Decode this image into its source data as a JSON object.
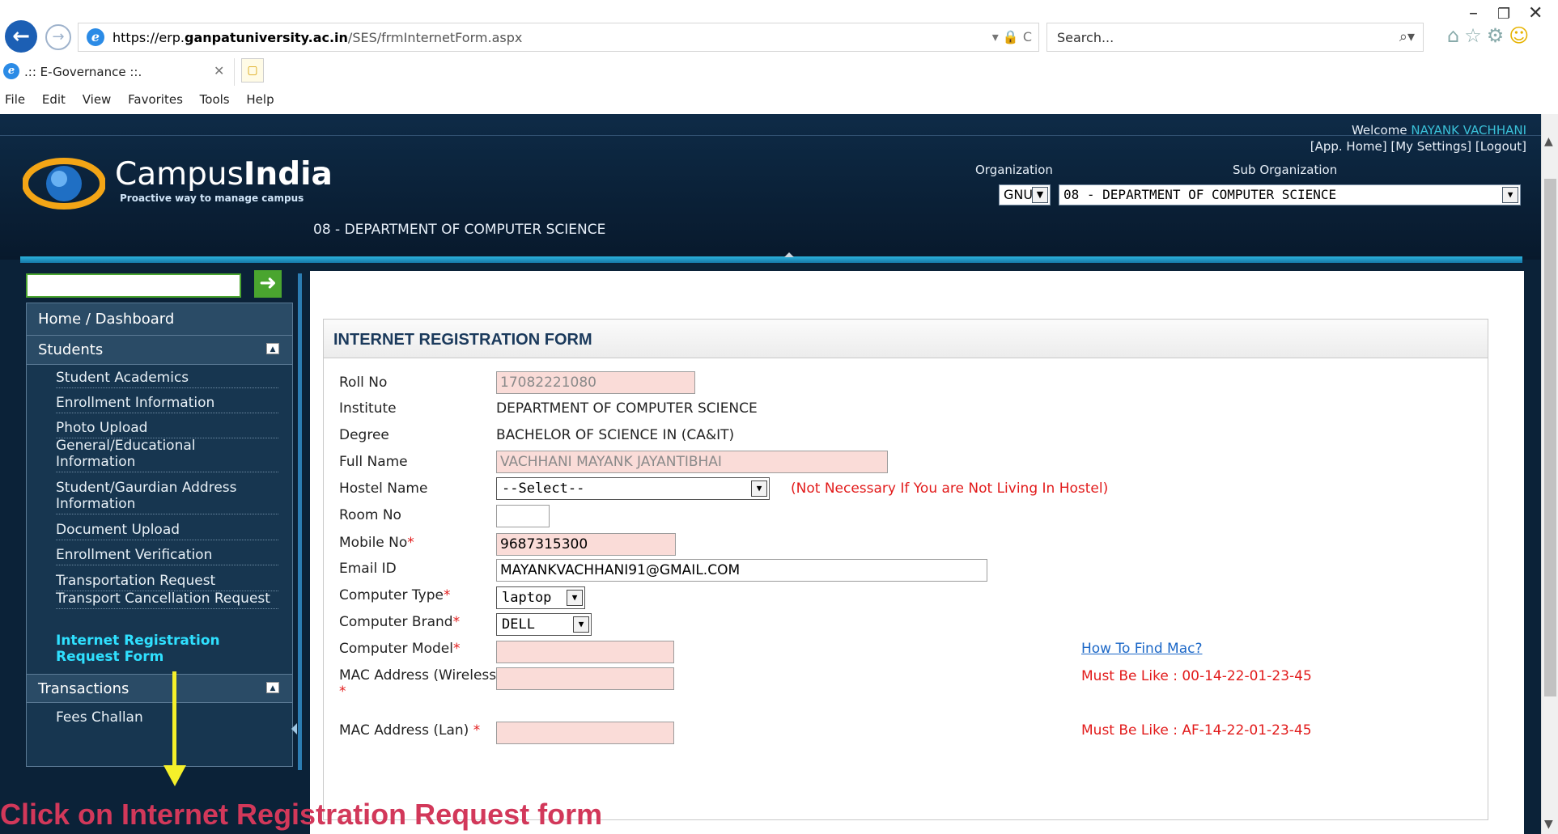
{
  "browser": {
    "url_prefix": "https://erp.",
    "url_domain": "ganpatuniversity.ac.in",
    "url_path": "/SES/frmInternetForm.aspx",
    "address_tools": "▾ 🔒 C",
    "search_placeholder": "Search...",
    "tab_title": ".:: E-Governance ::.",
    "menu": [
      "File",
      "Edit",
      "View",
      "Favorites",
      "Tools",
      "Help"
    ]
  },
  "header": {
    "logo_campus": "Campus",
    "logo_india": "India",
    "logo_tagline": "Proactive way to manage campus",
    "welcome_prefix": "Welcome",
    "user_name": "NAYANK VACHHANI",
    "links": "[App. Home] [My Settings] [Logout]",
    "org_label": "Organization",
    "suborg_label": "Sub Organization",
    "org_value": "GNU",
    "suborg_value": "08 - DEPARTMENT OF COMPUTER SCIENCE",
    "dept_title": "08 - DEPARTMENT OF COMPUTER SCIENCE"
  },
  "sidebar": {
    "home": "Home / Dashboard",
    "students": "Students",
    "items": [
      "Student Academics",
      "Enrollment Information",
      "Photo Upload",
      "General/Educational Information",
      "Student/Gaurdian Address Information",
      "Document Upload",
      "Enrollment Verification",
      "Transportation Request",
      "Transport Cancellation Request",
      "Internet Registration Request Form"
    ],
    "transactions": "Transactions",
    "transaction_items": [
      "Fees Challan"
    ]
  },
  "form": {
    "title": "INTERNET REGISTRATION FORM",
    "roll_no_label": "Roll No",
    "roll_no": "17082221080",
    "institute_label": "Institute",
    "institute": "DEPARTMENT OF COMPUTER SCIENCE",
    "degree_label": "Degree",
    "degree": "BACHELOR OF SCIENCE IN (CA&IT)",
    "full_name_label": "Full Name",
    "full_name": "VACHHANI MAYANK JAYANTIBHAI",
    "hostel_label": "Hostel Name",
    "hostel_value": "--Select--",
    "hostel_note": "(Not Necessary If You are Not Living In Hostel)",
    "room_label": "Room No",
    "room_value": "",
    "mobile_label": "Mobile No",
    "mobile": "9687315300",
    "email_label": "Email ID",
    "email": "MAYANKVACHHANI91@GMAIL.COM",
    "computer_type_label": "Computer Type",
    "computer_type": "laptop",
    "computer_brand_label": "Computer Brand",
    "computer_brand": "DELL",
    "computer_model_label": "Computer Model",
    "computer_model": "",
    "mac_wireless_label": "MAC Address (Wireless)",
    "mac_wireless": "",
    "mac_lan_label": "MAC Address (Lan)",
    "mac_lan": "",
    "how_to_find_mac": "How To Find Mac?",
    "mac_wireless_hint": "Must Be Like : 00-14-22-01-23-45",
    "mac_lan_hint": "Must Be Like : AF-14-22-01-23-45",
    "required_mark": "*"
  },
  "annotation": {
    "text": "Click on Internet Registration Request form"
  },
  "colors": {
    "accent_cyan": "#2fe0ff",
    "required_red": "#e21b1b",
    "annotation_pink": "#d2385a",
    "annotation_arrow": "#f5f02a"
  }
}
